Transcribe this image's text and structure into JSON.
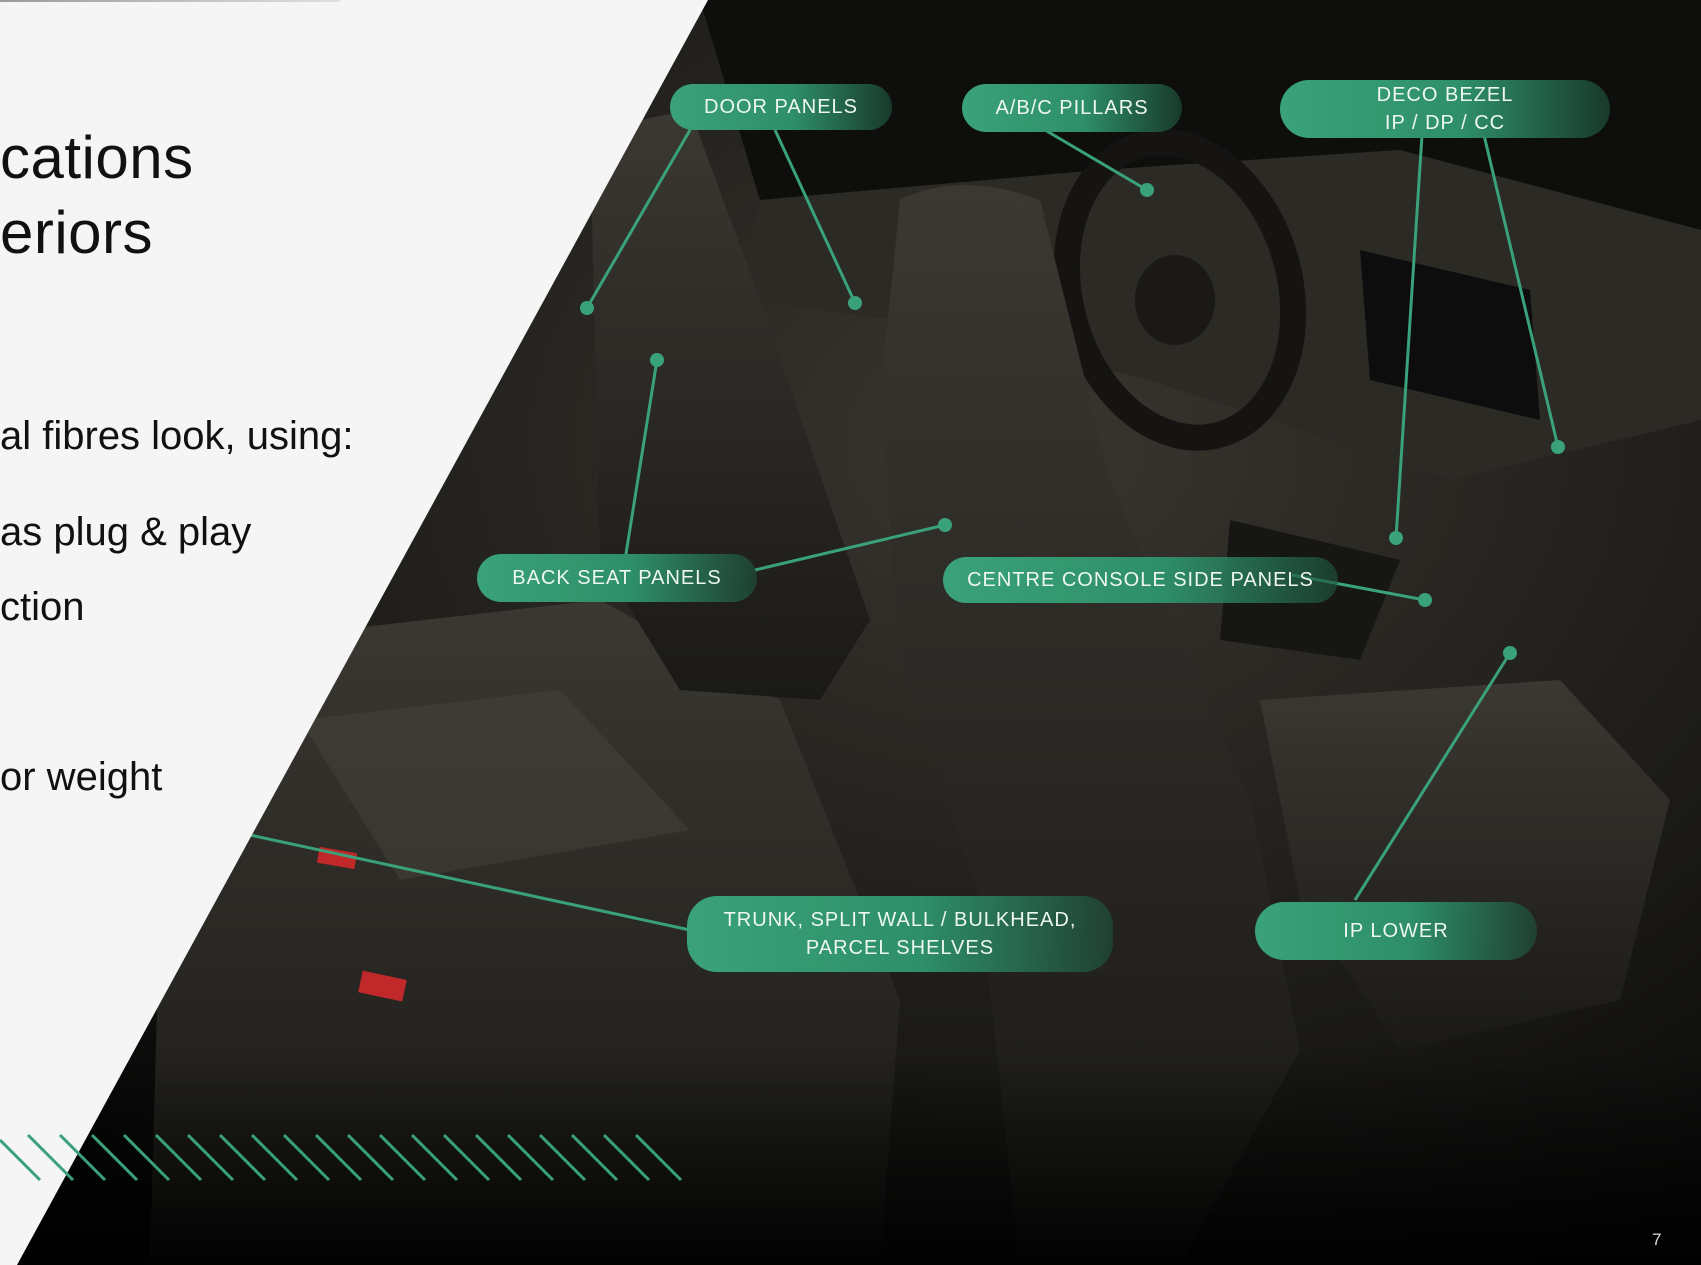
{
  "slide": {
    "headline": [
      "cations",
      "eriors"
    ],
    "body_lines": [
      "al fibres look, using:",
      "as plug & play",
      "ction",
      "or weight"
    ],
    "page_number": "7"
  },
  "labels": {
    "door_panels": "DOOR PANELS",
    "pillars": "A/B/C PILLARS",
    "deco_bezel_line1": "DECO BEZEL",
    "deco_bezel_line2": "IP / DP / CC",
    "back_seat_panels": "BACK SEAT PANELS",
    "centre_console": "CENTRE CONSOLE SIDE PANELS",
    "trunk_line1": "TRUNK, SPLIT WALL / BULKHEAD,",
    "trunk_line2": "PARCEL SHELVES",
    "ip_lower": "IP LOWER"
  },
  "colors": {
    "accent": "#3aa27a",
    "panel": "#f5f5f5",
    "text": "#111111"
  }
}
